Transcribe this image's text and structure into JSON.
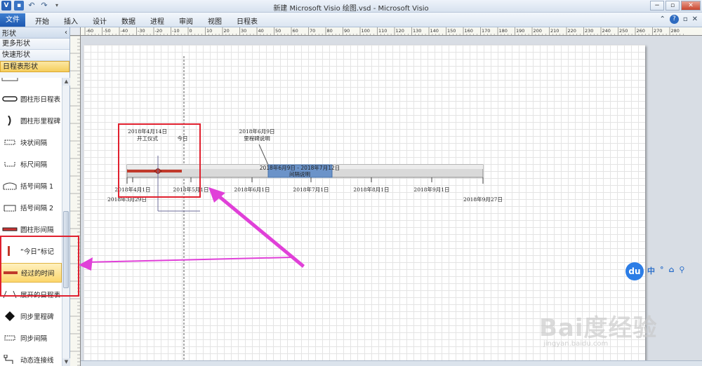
{
  "window": {
    "title": "新建 Microsoft Visio 绘图.vsd  -  Microsoft Visio",
    "minimize": "−",
    "maximize": "▫",
    "close": "✕"
  },
  "ribbon": {
    "file_tab": "文件",
    "tabs": [
      "开始",
      "插入",
      "设计",
      "数据",
      "进程",
      "审阅",
      "视图",
      "日程表"
    ],
    "help": "?"
  },
  "shapes_pane": {
    "title": "形状",
    "collapse": "‹",
    "rows": [
      "更多形状",
      "快速形状",
      "日程表形状"
    ],
    "items": [
      {
        "label": "圆柱形日程表",
        "icon": "cylinder-timeline-icon"
      },
      {
        "label": "圆柱形里程碑",
        "icon": "cylinder-milestone-icon"
      },
      {
        "label": "块状间隔",
        "icon": "block-interval-icon"
      },
      {
        "label": "标尺间隔",
        "icon": "ruler-interval-icon"
      },
      {
        "label": "括号间隔 1",
        "icon": "bracket-interval-1-icon"
      },
      {
        "label": "括号间隔 2",
        "icon": "bracket-interval-2-icon"
      },
      {
        "label": "圆柱形间隔",
        "icon": "cylinder-interval-icon"
      },
      {
        "label": "“今日”标记",
        "icon": "today-marker-icon"
      },
      {
        "label": "经过的时间",
        "icon": "elapsed-time-icon"
      },
      {
        "label": "展开的日程表",
        "icon": "expanded-timeline-icon"
      },
      {
        "label": "同步里程碑",
        "icon": "synced-milestone-icon"
      },
      {
        "label": "同步间隔",
        "icon": "synced-interval-icon"
      },
      {
        "label": "动态连接线",
        "icon": "dynamic-connector-icon"
      }
    ]
  },
  "ruler_labels": [
    "-60",
    "-50",
    "-40",
    "-30",
    "-20",
    "-10",
    "0",
    "10",
    "20",
    "30",
    "40",
    "50",
    "60",
    "70",
    "80",
    "90",
    "100",
    "110",
    "120",
    "130",
    "140",
    "150",
    "160",
    "170",
    "180",
    "190",
    "200",
    "210",
    "220",
    "230",
    "240",
    "250",
    "260",
    "270",
    "280"
  ],
  "timeline": {
    "milestone_1": {
      "date": "2018年4月14日",
      "label": "开工仪式"
    },
    "today_label": "今日",
    "milestone_2": {
      "date": "2018年6月9日",
      "label": "里程碑说明"
    },
    "interval": {
      "range": "2018年6月9日 - 2018年7月12日",
      "label": "间隔说明"
    },
    "ticks": [
      "2018年4月1日",
      "2018年5月1日",
      "2018年6月1日",
      "2018年7月1日",
      "2018年8月1日",
      "2018年9月1日"
    ],
    "start": "2018年3月29日",
    "end": "2018年9月27日",
    "colors": {
      "elapsed": "#c0392b",
      "interval": "#6b93c9",
      "bar": "#d8d8d8",
      "annotation": "#e0202e",
      "arrow": "#e040d8"
    }
  },
  "baidu": {
    "logo": "du",
    "tools": [
      "中",
      "°",
      "⌂",
      "⚲"
    ],
    "watermark": "Bai度经验",
    "watermark_sub": "jingyan.baidu.com"
  }
}
